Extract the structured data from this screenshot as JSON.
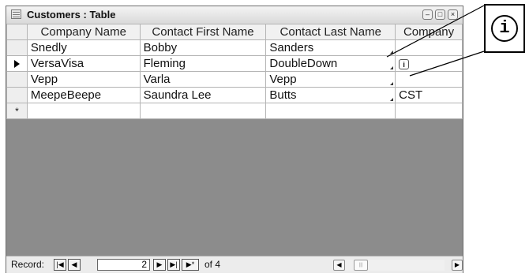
{
  "window": {
    "title": "Customers : Table",
    "buttons": {
      "minimize": "–",
      "maximize": "□",
      "close": "×"
    }
  },
  "table": {
    "columns": [
      "Company Name",
      "Contact First Name",
      "Contact Last Name",
      "Company"
    ],
    "rows": [
      {
        "selector": "",
        "cells": [
          "Snedly",
          "Bobby",
          "Sanders",
          ""
        ]
      },
      {
        "selector": "current-record-indicator",
        "cells": [
          "VersaVisa",
          "Fleming",
          "DoubleDown",
          ""
        ]
      },
      {
        "selector": "",
        "cells": [
          "Vepp",
          "Varla",
          "Vepp",
          ""
        ]
      },
      {
        "selector": "",
        "cells": [
          "MeepeBeepe",
          "Saundra Lee",
          "Butts",
          "CST"
        ]
      }
    ],
    "new_row_selector": "*"
  },
  "navigation": {
    "label": "Record:",
    "current_record": "2",
    "of_text": "of 4",
    "buttons": {
      "first": "|◀",
      "prev": "◀",
      "next": "▶",
      "last": "▶|",
      "new": "▶*"
    }
  },
  "scrollbar": {
    "left": "◀",
    "right": "▶",
    "thumb": "|||"
  },
  "callout": {
    "icon": "i",
    "icon_name": "smart-tag-info-icon"
  }
}
